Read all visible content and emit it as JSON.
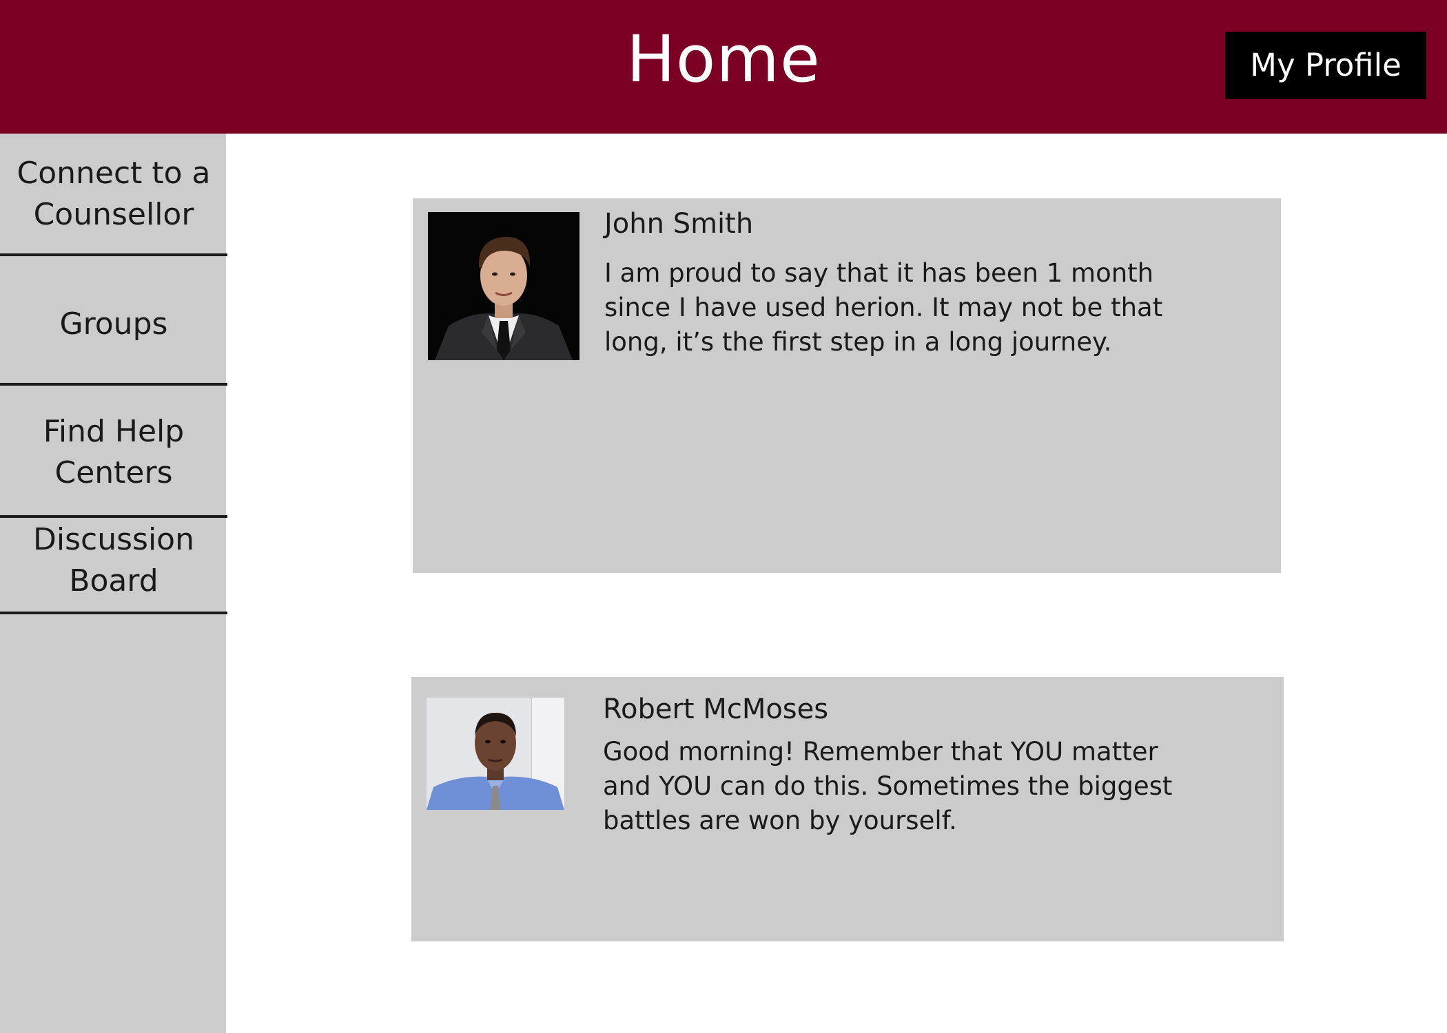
{
  "header": {
    "title": "Home",
    "profile_button": "My Profile"
  },
  "sidebar": {
    "items": [
      {
        "label": "Connect to a Counsellor"
      },
      {
        "label": "Groups"
      },
      {
        "label": "Find Help Centers"
      },
      {
        "label": "Discussion Board"
      }
    ]
  },
  "posts": [
    {
      "author": "John Smith",
      "text": "I am proud to say that it has been 1 month since I have used herion. It may not be that long, it’s the first step in a long journey.",
      "avatar_icon": "person-in-suit-photo"
    },
    {
      "author": "Robert McMoses",
      "text": "Good morning! Remember that YOU matter and YOU can do this. Sometimes the biggest battles are won by yourself.",
      "avatar_icon": "person-in-blue-shirt-photo"
    }
  ],
  "colors": {
    "header_bg": "#7b0024",
    "sidebar_bg": "#cccccc",
    "card_bg": "#cccccc",
    "profile_button_bg": "#000000"
  }
}
